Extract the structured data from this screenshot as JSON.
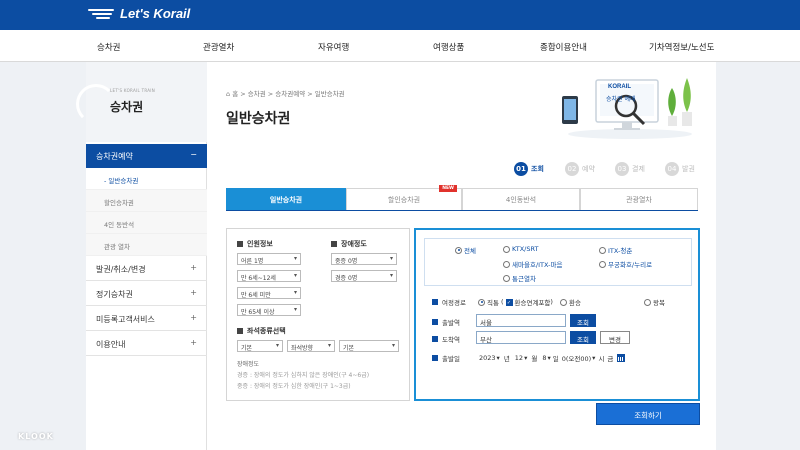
{
  "header": {
    "logo_text": "Let's Korail"
  },
  "gnb": [
    "승차권",
    "관광열차",
    "자유여행",
    "여행상품",
    "종합이용안내",
    "기차역정보/노선도"
  ],
  "lnb": {
    "subtitle": "LET'S KORAIL TRAIN",
    "title": "승차권",
    "active_label": "승차권예약",
    "active_toggle": "−",
    "sub_items": [
      "- 일반승차권",
      "할인승차권",
      "4인 동반석",
      "관광 열차"
    ],
    "items": [
      {
        "label": "발권/취소/변경",
        "toggle": "+"
      },
      {
        "label": "정기승차권",
        "toggle": "+"
      },
      {
        "label": "미등록고객서비스",
        "toggle": "+"
      },
      {
        "label": "이용안내",
        "toggle": "+"
      }
    ]
  },
  "breadcrumb": "⌂  홈  >  승차권  >  승차권예약  >  일반승차권",
  "page_title": "일반승차권",
  "hero": {
    "brand": "KORAIL",
    "caption": "승차권 예매"
  },
  "steps": [
    {
      "num": "01",
      "label": "조회"
    },
    {
      "num": "02",
      "label": "예약"
    },
    {
      "num": "03",
      "label": "결제"
    },
    {
      "num": "04",
      "label": "발권"
    }
  ],
  "tabs": [
    "일반승차권",
    "할인승차권",
    "4인동반석",
    "관광열차"
  ],
  "new_badge": "NEW",
  "passengers": {
    "title": "인원정보",
    "selects": [
      "어른 1명",
      "만 6세~12세",
      "만 6세 미만",
      "만 65세 이상"
    ],
    "disability_title": "장애정도",
    "disability_selects": [
      "중증 0명",
      "경증 0명"
    ]
  },
  "seat": {
    "title": "좌석종류선택",
    "selects": [
      "기본",
      "좌석방향",
      "기본"
    ],
    "note_title": "장애정도",
    "note_1": "경증 : 장애의 정도가 심하지 않은 장애인(구 4~6급)",
    "note_2": "중증 : 장애의 정도가 심한 장애인(구 1~3급)"
  },
  "train_types": [
    "전체",
    "KTX/SRT",
    "ITX-청춘",
    "새마을호/ITX-마음",
    "무궁화호/누리로",
    "통근열차"
  ],
  "route": {
    "label": "여정경로",
    "direct": "직통",
    "transfer_check": "환승연계포함",
    "transfer": "환승",
    "roundtrip": "왕복"
  },
  "depart": {
    "label": "출발역",
    "value": "서울",
    "button": "조회"
  },
  "arrive": {
    "label": "도착역",
    "value": "부산",
    "button": "조회",
    "swap": "변경"
  },
  "date": {
    "label": "출발일",
    "year": "2023",
    "year_unit": "년",
    "month": "12",
    "month_unit": "월",
    "day": "8",
    "day_unit": "일",
    "hour": "0(오전00)",
    "hour_unit": "시",
    "extra": "금"
  },
  "search_button": "조회하기",
  "watermark": "KLOOK",
  "colors": {
    "brand": "#0c4da2",
    "tab_active": "#1a8fd6",
    "new": "#e1322c"
  }
}
